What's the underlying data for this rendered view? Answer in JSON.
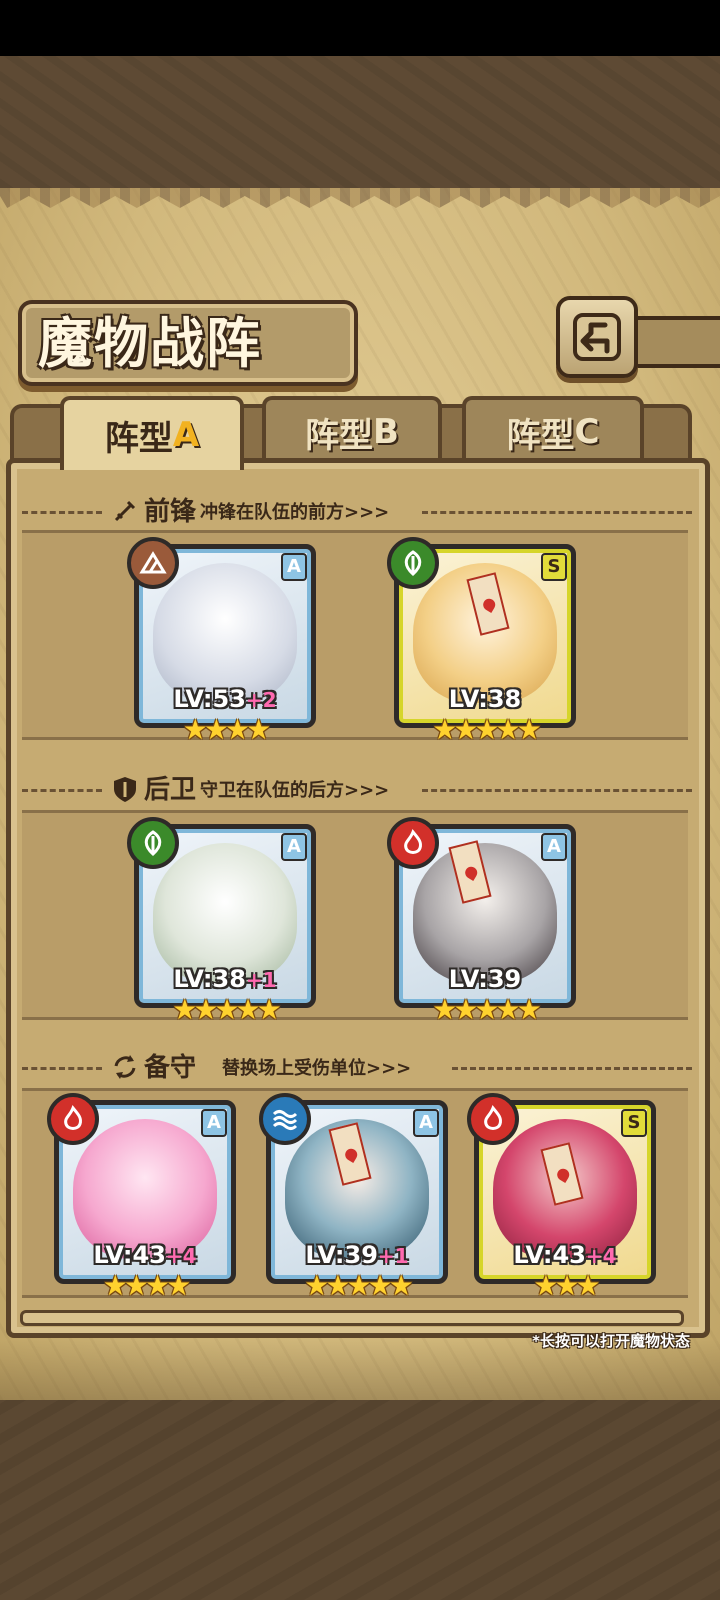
{
  "title": "魔物战阵",
  "tabs": [
    {
      "label": "阵型",
      "letter": "A",
      "active": true
    },
    {
      "label": "阵型",
      "letter": "B",
      "active": false
    },
    {
      "label": "阵型",
      "letter": "C",
      "active": false
    }
  ],
  "sections": {
    "front": {
      "name": "前锋",
      "desc": "冲锋在队伍的前方>>>",
      "icon": "sword-icon"
    },
    "back": {
      "name": "后卫",
      "desc": "守卫在队伍的后方>>>",
      "icon": "shield-icon"
    },
    "reserve": {
      "name": "备守",
      "desc": "替换场上受伤单位>>>",
      "icon": "swap-icon"
    }
  },
  "cards": {
    "front1": {
      "level": "LV:53",
      "plus": "+2",
      "rank": "A",
      "element": "earth-icon",
      "stars": "★★★★"
    },
    "front2": {
      "level": "LV:38",
      "plus": "",
      "rank": "S",
      "element": "leaf-icon",
      "stars": "★★★★★"
    },
    "back1": {
      "level": "LV:38",
      "plus": "+1",
      "rank": "A",
      "element": "leaf-icon",
      "stars": "★★★★★"
    },
    "back2": {
      "level": "LV:39",
      "plus": "",
      "rank": "A",
      "element": "fire-icon",
      "stars": "★★★★★"
    },
    "res1": {
      "level": "LV:43",
      "plus": "+4",
      "rank": "A",
      "element": "fire-icon",
      "stars": "★★★★"
    },
    "res2": {
      "level": "LV:39",
      "plus": "+1",
      "rank": "A",
      "element": "water-icon",
      "stars": "★★★★★"
    },
    "res3": {
      "level": "LV:43",
      "plus": "+4",
      "rank": "S",
      "element": "fire-icon",
      "stars": "★★★"
    }
  },
  "footer_note": "*长按可以打开魔物状态",
  "colors": {
    "earth": "#9a5a3a",
    "leaf": "#3b8a2a",
    "fire": "#d2302a",
    "water": "#2a7ab8"
  }
}
